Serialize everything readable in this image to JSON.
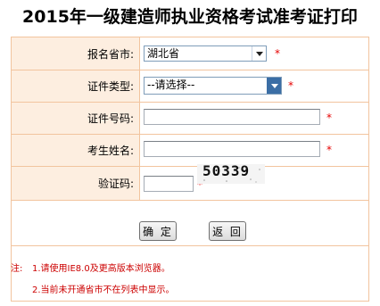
{
  "page": {
    "title": "2015年一级建造师执业资格考试准考证打印"
  },
  "form": {
    "province": {
      "label": "报名省市:",
      "selected": "湖北省",
      "required_mark": "*"
    },
    "id_type": {
      "label": "证件类型:",
      "selected": "--请选择--",
      "required_mark": "*"
    },
    "id_number": {
      "label": "证件号码:",
      "value": "",
      "required_mark": "*"
    },
    "name": {
      "label": "考生姓名:",
      "value": "",
      "required_mark": "*"
    },
    "captcha": {
      "label": "验证码:",
      "value": "",
      "required_mark": "*",
      "image_text": "50339"
    }
  },
  "buttons": {
    "confirm": "确 定",
    "back": "返 回"
  },
  "notes": {
    "prefix": "注:",
    "line1": "1.请使用IE8.0及更高版本浏览器。",
    "line2": "2.当前未开通省市不在列表中显示。"
  },
  "colors": {
    "border": "#f2c49e",
    "label_bg": "#fdeee0",
    "required": "#e60000",
    "note": "#cc0000"
  },
  "icons": {
    "dropdown": "chevron-down-icon"
  }
}
